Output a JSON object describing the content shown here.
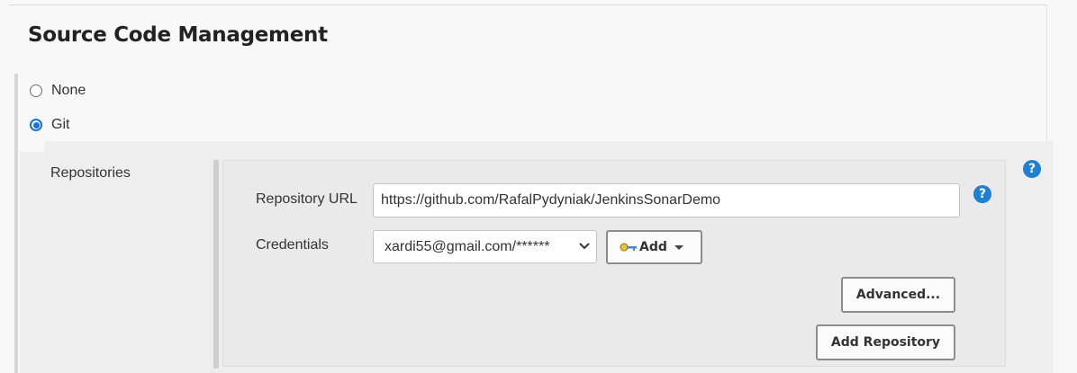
{
  "section": {
    "title": "Source Code Management"
  },
  "scm_options": [
    {
      "label": "None",
      "checked": false
    },
    {
      "label": "Git",
      "checked": true
    }
  ],
  "git": {
    "repositories_label": "Repositories",
    "repository_url_label": "Repository URL",
    "repository_url_value": "https://github.com/RafalPydyniak/JenkinsSonarDemo",
    "credentials_label": "Credentials",
    "credentials_selected": "xardi55@gmail.com/******",
    "add_label": "Add",
    "advanced_label": "Advanced...",
    "add_repository_label": "Add Repository",
    "help_glyph": "?"
  },
  "icons": {
    "help": "help-icon",
    "key": "key-icon",
    "caret": "caret-down-icon"
  },
  "colors": {
    "accent": "#1a6fd8",
    "help": "#1f7fd1",
    "panel": "#eeeeee"
  }
}
